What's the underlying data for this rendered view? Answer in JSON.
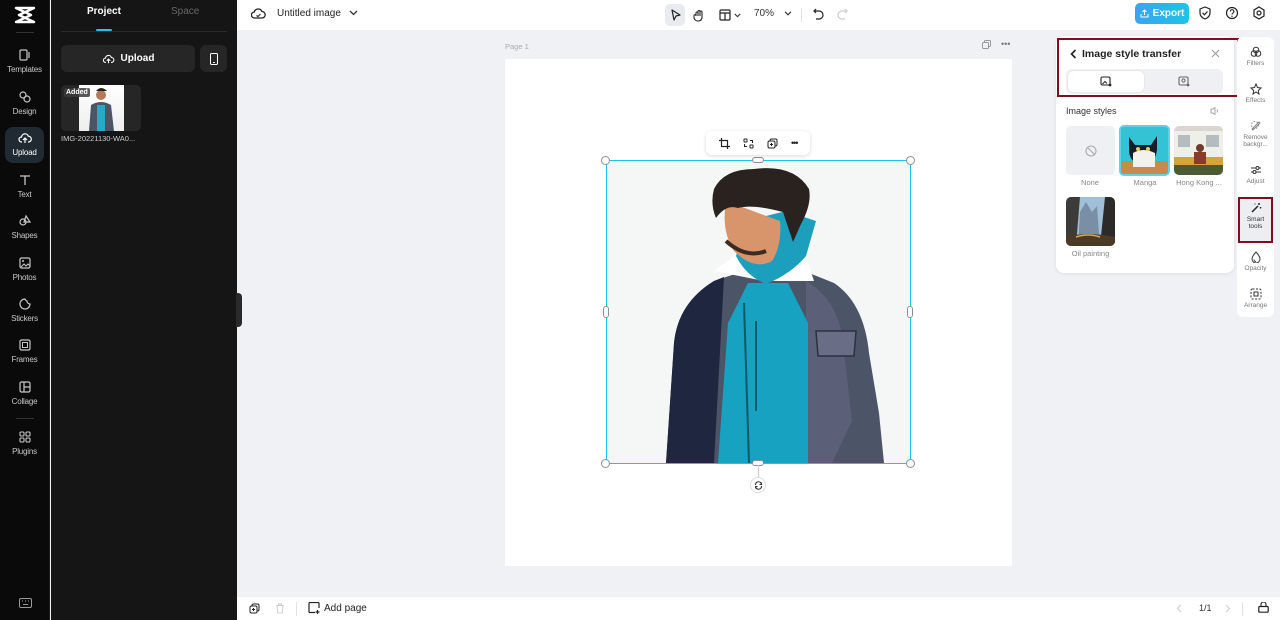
{
  "left_rail": {
    "items": [
      {
        "label": "Templates",
        "icon": "templates-icon"
      },
      {
        "label": "Design",
        "icon": "design-icon"
      },
      {
        "label": "Upload",
        "icon": "upload-cloud-icon",
        "active": true
      },
      {
        "label": "Text",
        "icon": "text-icon"
      },
      {
        "label": "Shapes",
        "icon": "shapes-icon"
      },
      {
        "label": "Photos",
        "icon": "photos-icon"
      },
      {
        "label": "Stickers",
        "icon": "stickers-icon"
      },
      {
        "label": "Frames",
        "icon": "frames-icon"
      },
      {
        "label": "Collage",
        "icon": "collage-icon"
      },
      {
        "label": "Plugins",
        "icon": "plugins-icon"
      }
    ]
  },
  "panel": {
    "tabs": [
      "Project",
      "Space"
    ],
    "active_tab": "Project",
    "upload_label": "Upload",
    "assets": [
      {
        "name": "IMG-20221130-WA0...",
        "badge": "Added"
      }
    ]
  },
  "topbar": {
    "title": "Untitled image",
    "zoom": "70%",
    "export_label": "Export"
  },
  "canvas": {
    "page_label": "Page 1"
  },
  "style_panel": {
    "title": "Image style transfer",
    "section_title": "Image styles",
    "styles": [
      {
        "label": "None",
        "selected": false
      },
      {
        "label": "Manga",
        "selected": true
      },
      {
        "label": "Hong Kong ...",
        "selected": false
      },
      {
        "label": "Oil painting",
        "selected": false
      }
    ]
  },
  "right_rail": {
    "items": [
      {
        "label": "Filters"
      },
      {
        "label": "Effects"
      },
      {
        "label": "Remove backgr..."
      },
      {
        "label": "Adjust"
      },
      {
        "label": "Smart tools",
        "selected": true
      },
      {
        "label": "Opacity"
      },
      {
        "label": "Arrange"
      }
    ]
  },
  "bottombar": {
    "add_page_label": "Add page",
    "pager": "1/1"
  },
  "colors": {
    "accent": "#20c3e5",
    "highlight": "#7a1020"
  }
}
